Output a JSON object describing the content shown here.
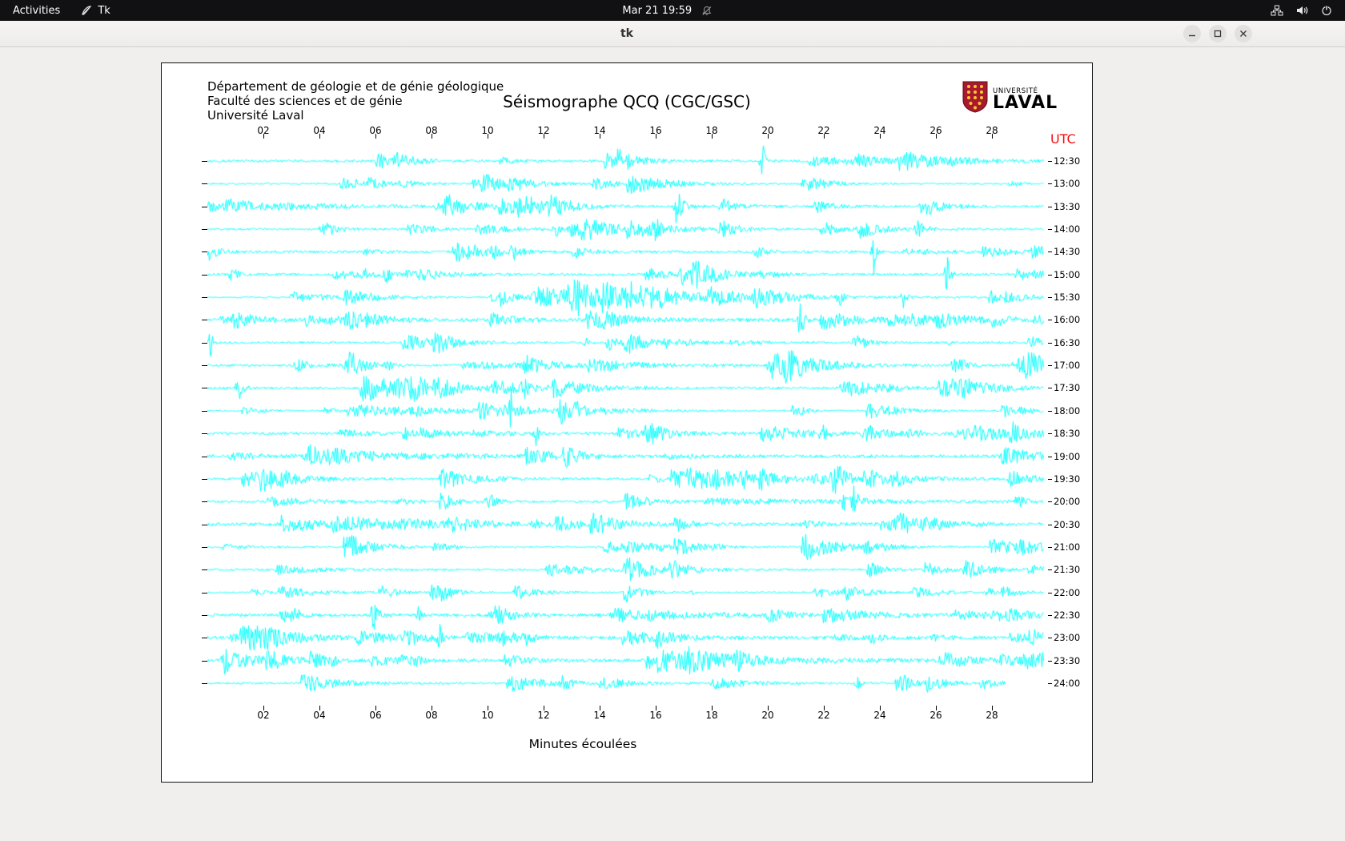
{
  "top_bar": {
    "activities_label": "Activities",
    "app_name": "Tk",
    "clock": "Mar 21 19:59",
    "icons": [
      "tk-app-icon",
      "bell-crossed-icon",
      "network-icon",
      "volume-icon",
      "power-icon"
    ]
  },
  "window": {
    "title": "tk"
  },
  "seismograph": {
    "org_lines": [
      "Département de géologie et de génie géologique",
      "Faculté des sciences et de génie",
      "Université Laval"
    ],
    "title": "Séismographe QCQ (CGC/GSC)",
    "utc_label": "UTC",
    "xlabel": "Minutes écoulées",
    "x_ticks": [
      "02",
      "04",
      "06",
      "08",
      "10",
      "12",
      "14",
      "16",
      "18",
      "20",
      "22",
      "24",
      "26",
      "28"
    ],
    "row_labels": [
      "12:30",
      "13:00",
      "13:30",
      "14:00",
      "14:30",
      "15:00",
      "15:30",
      "16:00",
      "16:30",
      "17:00",
      "17:30",
      "18:00",
      "18:30",
      "19:00",
      "19:30",
      "20:00",
      "20:30",
      "21:00",
      "21:30",
      "22:00",
      "22:30",
      "23:00",
      "23:30",
      "24:00"
    ],
    "trace_color": "#00ffff",
    "logo": {
      "line1": "UNIVERSITÉ",
      "line2": "LAVAL",
      "shield_red": "#a6192e",
      "shield_gold": "#ffc72c"
    }
  },
  "chart_data": {
    "type": "line",
    "title": "Séismographe QCQ (CGC/GSC)",
    "xlabel": "Minutes écoulées",
    "x_range_minutes": [
      0,
      30
    ],
    "x_tick_labels": [
      "02",
      "04",
      "06",
      "08",
      "10",
      "12",
      "14",
      "16",
      "18",
      "20",
      "22",
      "24",
      "26",
      "28"
    ],
    "right_axis_title": "UTC",
    "rows_utc": [
      "12:30",
      "13:00",
      "13:30",
      "14:00",
      "14:30",
      "15:00",
      "15:30",
      "16:00",
      "16:30",
      "17:00",
      "17:30",
      "18:00",
      "18:30",
      "19:00",
      "19:30",
      "20:00",
      "20:30",
      "21:00",
      "21:30",
      "22:00",
      "22:30",
      "23:00",
      "23:30",
      "24:00"
    ],
    "trace_color": "#00ffff"
  }
}
